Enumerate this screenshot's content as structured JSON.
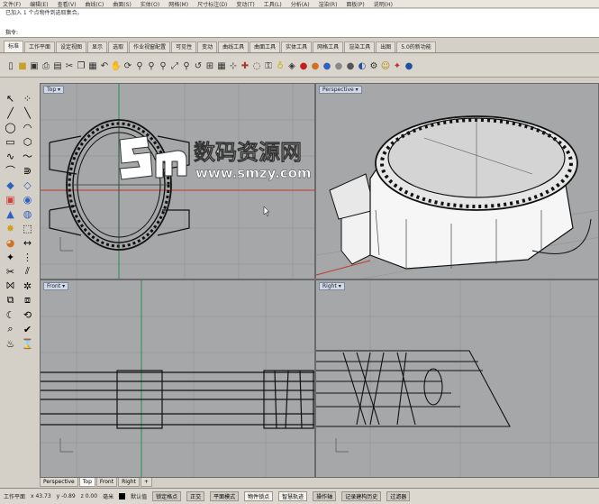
{
  "menubar": {
    "items": [
      "文件(F)",
      "编辑(E)",
      "查看(V)",
      "曲线(C)",
      "曲面(S)",
      "实体(O)",
      "网格(M)",
      "尺寸标注(D)",
      "变动(T)",
      "工具(L)",
      "分析(A)",
      "渲染(R)",
      "面板(P)",
      "说明(H)"
    ]
  },
  "command": {
    "history": [
      "已加入 1 个点物件到选取集合。"
    ],
    "prompt": "指令:"
  },
  "tabs": [
    "标准",
    "工作平面",
    "设定视图",
    "显示",
    "选取",
    "作业视窗配置",
    "可见性",
    "变动",
    "曲线工具",
    "曲面工具",
    "实体工具",
    "网格工具",
    "渲染工具",
    "出图",
    "5.0的新功能"
  ],
  "viewports": {
    "top": {
      "title": "Top ▾"
    },
    "perspective": {
      "title": "Perspective ▾"
    },
    "front": {
      "title": "Front ▾"
    },
    "right": {
      "title": "Right ▾"
    }
  },
  "viewport_tabs": [
    "Perspective",
    "Top",
    "Front",
    "Right",
    "+"
  ],
  "status": {
    "cplane": "工作平面",
    "x": "x 43.73",
    "y": "y -0.89",
    "z": "z 0.00",
    "unit": "毫米",
    "layer": "默认值",
    "buttons": [
      "锁定格点",
      "正交",
      "平面模式",
      "物件锁点",
      "智慧轨迹",
      "操作轴",
      "记录建构历史",
      "过滤器"
    ]
  },
  "watermark": {
    "brand": "数码资源网",
    "url": "www.smzy.com"
  },
  "colors": {
    "viewport_bg": "#a6a7a8",
    "active_tab": "#cfd8e3",
    "axis_red": "#c0392b",
    "axis_green": "#2e8b57",
    "watermark": "#ffffff"
  }
}
